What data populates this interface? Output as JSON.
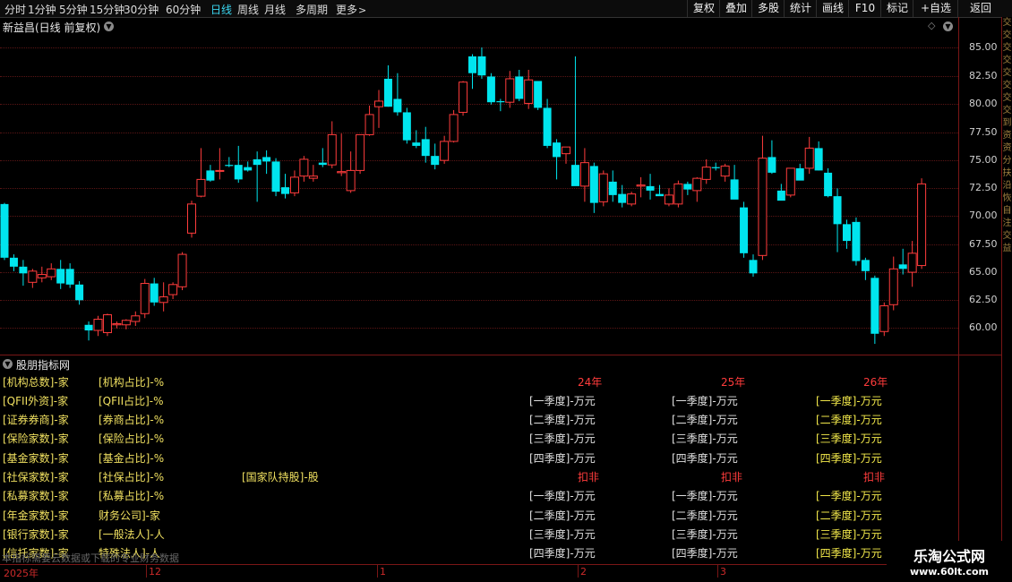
{
  "toolbar": {
    "periods": [
      "分时",
      "1分钟",
      "5分钟",
      "15分钟",
      "30分钟",
      "60分钟",
      "日线",
      "周线",
      "月线",
      "多周期",
      "更多"
    ],
    "active_period": "日线",
    "tools": [
      "复权",
      "叠加",
      "多股",
      "统计",
      "画线",
      "F10",
      "标记",
      "+自选",
      "返回"
    ]
  },
  "chart": {
    "title": "新益昌(日线 前复权)",
    "price_ticks": [
      "85.00",
      "82.50",
      "80.00",
      "77.50",
      "75.00",
      "72.50",
      "70.00",
      "67.50",
      "65.00",
      "62.50",
      "60.00"
    ],
    "up_color": "#ff3c3c",
    "down_color": "#00e5ee"
  },
  "chart_data": {
    "type": "candlestick",
    "title": "新益昌(日线 前复权)",
    "ylim": [
      58.5,
      87
    ],
    "y_ticks": [
      85,
      82.5,
      80,
      77.5,
      75,
      72.5,
      70,
      67.5,
      65,
      62.5,
      60
    ],
    "candles": [
      [
        71.8,
        71.9,
        66.8,
        67.0
      ],
      [
        67.0,
        67.3,
        65.8,
        66.2
      ],
      [
        66.2,
        66.8,
        64.5,
        65.6
      ],
      [
        64.8,
        66.0,
        64.3,
        65.8
      ],
      [
        65.2,
        66.2,
        64.8,
        65.5
      ],
      [
        65.3,
        66.5,
        65.0,
        66.0
      ],
      [
        66.0,
        66.8,
        64.2,
        64.7
      ],
      [
        66.0,
        66.5,
        64.3,
        64.6
      ],
      [
        64.6,
        64.9,
        62.8,
        63.2
      ],
      [
        61.0,
        61.3,
        59.6,
        60.5
      ],
      [
        60.5,
        61.8,
        60.0,
        61.5
      ],
      [
        60.3,
        62.0,
        60.0,
        61.9
      ],
      [
        61.0,
        61.3,
        60.7,
        61.1
      ],
      [
        61.0,
        61.5,
        60.6,
        61.4
      ],
      [
        61.3,
        62.2,
        60.9,
        61.8
      ],
      [
        62.0,
        65.1,
        61.6,
        64.7
      ],
      [
        64.7,
        65.2,
        62.7,
        63.0
      ],
      [
        63.0,
        64.8,
        62.2,
        63.5
      ],
      [
        63.7,
        64.8,
        63.3,
        64.6
      ],
      [
        64.4,
        67.5,
        64.1,
        67.3
      ],
      [
        69.2,
        72.1,
        68.8,
        71.8
      ],
      [
        72.5,
        76.8,
        72.4,
        74.0
      ],
      [
        74.8,
        75.3,
        73.8,
        73.9
      ],
      [
        74.8,
        76.8,
        74.0,
        74.8
      ],
      [
        75.3,
        76.0,
        75.1,
        75.2
      ],
      [
        75.3,
        77.0,
        73.7,
        74.0
      ],
      [
        75.1,
        75.6,
        74.7,
        74.8
      ],
      [
        75.8,
        76.5,
        72.0,
        75.3
      ],
      [
        76.0,
        76.6,
        74.5,
        75.6
      ],
      [
        75.6,
        75.9,
        72.5,
        72.9
      ],
      [
        73.3,
        74.5,
        72.3,
        72.7
      ],
      [
        72.8,
        74.8,
        72.5,
        74.2
      ],
      [
        74.3,
        76.1,
        73.8,
        75.8
      ],
      [
        74.1,
        75.3,
        73.8,
        74.3
      ],
      [
        75.5,
        76.8,
        75.1,
        75.3
      ],
      [
        75.3,
        79.2,
        75.0,
        78.0
      ],
      [
        74.6,
        78.1,
        74.3,
        74.7
      ],
      [
        73.0,
        76.5,
        72.8,
        74.8
      ],
      [
        74.8,
        78.0,
        74.5,
        78.0
      ],
      [
        78.0,
        80.6,
        77.9,
        79.8
      ],
      [
        80.5,
        82.0,
        78.6,
        81.0
      ],
      [
        83.0,
        84.2,
        80.5,
        80.5
      ],
      [
        81.2,
        83.5,
        79.7,
        80.0
      ],
      [
        80.0,
        80.4,
        77.2,
        77.5
      ],
      [
        77.3,
        78.4,
        76.8,
        77.0
      ],
      [
        77.6,
        78.7,
        75.5,
        76.1
      ],
      [
        76.1,
        77.2,
        74.9,
        75.3
      ],
      [
        75.7,
        77.9,
        75.4,
        77.4
      ],
      [
        77.4,
        80.2,
        77.3,
        79.8
      ],
      [
        80.0,
        82.8,
        79.7,
        82.7
      ],
      [
        85.0,
        85.2,
        82.1,
        83.5
      ],
      [
        85.0,
        85.8,
        83.0,
        83.3
      ],
      [
        83.2,
        83.5,
        80.7,
        80.9
      ],
      [
        81.0,
        81.2,
        80.1,
        80.9
      ],
      [
        80.9,
        83.7,
        80.4,
        83.0
      ],
      [
        83.2,
        83.8,
        81.0,
        81.2
      ],
      [
        80.8,
        83.8,
        80.3,
        82.9
      ],
      [
        82.8,
        82.6,
        80.2,
        80.4
      ],
      [
        80.4,
        81.2,
        76.8,
        77.0
      ],
      [
        77.3,
        77.6,
        74.0,
        76.0
      ],
      [
        76.3,
        76.8,
        75.4,
        76.9
      ],
      [
        75.3,
        85.0,
        74.5,
        73.4
      ],
      [
        73.4,
        76.8,
        72.0,
        75.5
      ],
      [
        75.2,
        75.5,
        71.0,
        71.9
      ],
      [
        72.0,
        74.8,
        71.6,
        74.5
      ],
      [
        73.8,
        74.8,
        72.0,
        72.6
      ],
      [
        72.7,
        73.5,
        71.5,
        71.9
      ],
      [
        71.8,
        72.9,
        71.6,
        72.7
      ],
      [
        73.4,
        74.2,
        72.4,
        73.5
      ],
      [
        73.4,
        74.5,
        72.2,
        73.0
      ],
      [
        72.7,
        73.5,
        72.6,
        72.5
      ],
      [
        71.8,
        73.2,
        71.6,
        72.6
      ],
      [
        71.8,
        73.9,
        71.5,
        73.6
      ],
      [
        73.6,
        73.8,
        72.6,
        73.1
      ],
      [
        73.0,
        74.2,
        72.0,
        74.1
      ],
      [
        74.0,
        75.8,
        73.6,
        75.1
      ],
      [
        75.1,
        75.5,
        74.8,
        75.0
      ],
      [
        74.3,
        75.4,
        73.8,
        75.2
      ],
      [
        74.0,
        75.3,
        73.0,
        72.2
      ],
      [
        71.5,
        72.0,
        67.0,
        67.4
      ],
      [
        66.8,
        67.3,
        65.3,
        65.6
      ],
      [
        67.2,
        77.9,
        66.8,
        75.9
      ],
      [
        76.0,
        77.5,
        74.5,
        74.6
      ],
      [
        73.0,
        73.6,
        72.3,
        72.1
      ],
      [
        72.6,
        74.8,
        72.4,
        75.0
      ],
      [
        75.0,
        75.4,
        74.0,
        73.9
      ],
      [
        75.0,
        77.8,
        74.5,
        76.8
      ],
      [
        76.8,
        77.4,
        74.8,
        74.8
      ],
      [
        74.6,
        75.0,
        72.4,
        72.5
      ],
      [
        72.5,
        73.2,
        67.5,
        70.0
      ],
      [
        70.0,
        70.4,
        67.8,
        68.5
      ],
      [
        70.2,
        70.6,
        66.3,
        66.7
      ],
      [
        66.8,
        67.0,
        65.0,
        65.8
      ],
      [
        65.2,
        65.4,
        59.3,
        60.2
      ],
      [
        60.4,
        63.0,
        60.0,
        62.7
      ],
      [
        62.8,
        67.1,
        62.3,
        66.0
      ],
      [
        66.4,
        67.8,
        65.5,
        66.0
      ],
      [
        65.7,
        68.5,
        64.4,
        67.4
      ],
      [
        66.3,
        74.1,
        66.0,
        73.6
      ]
    ]
  },
  "indicator": {
    "title": "股朋指标网",
    "col1": [
      "[机构总数]-家",
      "[QFII外资]-家",
      "[证券券商]-家",
      "[保险家数]-家",
      "[基金家数]-家",
      "[社保家数]-家",
      "[私募家数]-家",
      "[年金家数]-家",
      "[银行家数]-家",
      "[信托家数]-家"
    ],
    "col2": [
      "[机构占比]-%",
      "[QFII占比]-%",
      "[券商占比]-%",
      "[保险占比]-%",
      "[基金占比]-%",
      "[社保占比]-%",
      "[私募占比]-%",
      "财务公司]-家",
      "[一般法人]-人",
      "特殊法人]-人"
    ],
    "national_team": "[国家队持股]-股",
    "years": [
      "24年",
      "25年",
      "26年"
    ],
    "deduct_label": "扣非",
    "quarters": [
      "[一季度]-万元",
      "[二季度]-万元",
      "[三季度]-万元",
      "[四季度]-万元"
    ],
    "note": "本指标需要云数据或下载的专业财务数据"
  },
  "dates": {
    "first": "2025年",
    "labels": [
      "12",
      "1",
      "2",
      "3"
    ]
  },
  "right_strip": [
    "交",
    "交",
    "交",
    "交",
    "交",
    "交",
    "交",
    "交",
    "到",
    "资",
    "资",
    "分",
    "扶",
    "沿",
    "恢",
    "自",
    "注",
    "交",
    "益"
  ],
  "watermark": {
    "name": "乐淘公式网",
    "url": "www.60lt.com"
  }
}
